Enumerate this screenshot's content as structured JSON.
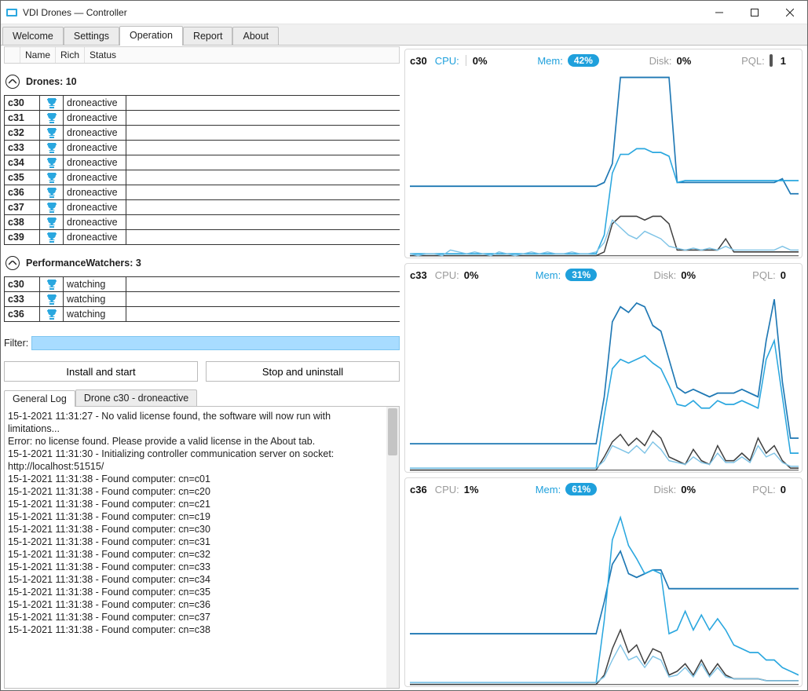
{
  "window": {
    "title": "VDI Drones — Controller"
  },
  "tabs": [
    "Welcome",
    "Settings",
    "Operation",
    "Report",
    "About"
  ],
  "active_tab": "Operation",
  "list_headers": [
    "Name",
    "Rich",
    "Status"
  ],
  "sections": {
    "drones": {
      "title": "Drones: 10",
      "rows": [
        {
          "name": "c30",
          "status": "droneactive"
        },
        {
          "name": "c31",
          "status": "droneactive"
        },
        {
          "name": "c32",
          "status": "droneactive"
        },
        {
          "name": "c33",
          "status": "droneactive"
        },
        {
          "name": "c34",
          "status": "droneactive"
        },
        {
          "name": "c35",
          "status": "droneactive"
        },
        {
          "name": "c36",
          "status": "droneactive"
        },
        {
          "name": "c37",
          "status": "droneactive"
        },
        {
          "name": "c38",
          "status": "droneactive"
        },
        {
          "name": "c39",
          "status": "droneactive"
        }
      ]
    },
    "watchers": {
      "title": "PerformanceWatchers: 3",
      "rows": [
        {
          "name": "c30",
          "status": "watching"
        },
        {
          "name": "c33",
          "status": "watching"
        },
        {
          "name": "c36",
          "status": "watching"
        }
      ]
    }
  },
  "filter": {
    "label": "Filter:",
    "value": ""
  },
  "buttons": {
    "install": "Install and start",
    "stop": "Stop and uninstall"
  },
  "log_tabs": [
    "General Log",
    "Drone c30 - droneactive"
  ],
  "active_log_tab": "General Log",
  "log_lines": [
    "15-1-2021 11:31:27 - No valid license found, the software will now run with limitations...",
    "Error: no license found. Please provide a valid license in the About tab.",
    "15-1-2021 11:31:30 - Initializing controller communication server on socket: http://localhost:51515/",
    "15-1-2021 11:31:38 - Found computer: cn=c01",
    "15-1-2021 11:31:38 - Found computer: cn=c20",
    "15-1-2021 11:31:38 - Found computer: cn=c21",
    "15-1-2021 11:31:38 - Found computer: cn=c19",
    "15-1-2021 11:31:38 - Found computer: cn=c30",
    "15-1-2021 11:31:38 - Found computer: cn=c31",
    "15-1-2021 11:31:38 - Found computer: cn=c32",
    "15-1-2021 11:31:38 - Found computer: cn=c33",
    "15-1-2021 11:31:38 - Found computer: cn=c34",
    "15-1-2021 11:31:38 - Found computer: cn=c35",
    "15-1-2021 11:31:38 - Found computer: cn=c36",
    "15-1-2021 11:31:38 - Found computer: cn=c37",
    "15-1-2021 11:31:38 - Found computer: cn=c38"
  ],
  "panels": [
    {
      "host": "c30",
      "labels": {
        "cpu": "CPU:",
        "mem": "Mem:",
        "disk": "Disk:",
        "pql": "PQL:"
      },
      "cpu": "0%",
      "mem": "42%",
      "disk": "0%",
      "pql": "1",
      "show_pql_ind": true,
      "show_cpu_sep": true
    },
    {
      "host": "c33",
      "labels": {
        "cpu": "CPU:",
        "mem": "Mem:",
        "disk": "Disk:",
        "pql": "PQL:"
      },
      "cpu": "0%",
      "mem": "31%",
      "disk": "0%",
      "pql": "0",
      "show_pql_ind": false,
      "show_cpu_sep": false
    },
    {
      "host": "c36",
      "labels": {
        "cpu": "CPU:",
        "mem": "Mem:",
        "disk": "Disk:",
        "pql": "PQL:"
      },
      "cpu": "1%",
      "mem": "61%",
      "disk": "0%",
      "pql": "0",
      "show_pql_ind": false,
      "show_cpu_sep": false
    }
  ],
  "chart_data": [
    {
      "type": "line",
      "host": "c30",
      "xrange": [
        0,
        480
      ],
      "yrange": [
        0,
        100
      ],
      "series": [
        {
          "name": "mem",
          "color": "#1f78b4",
          "values": [
            38,
            38,
            38,
            38,
            38,
            38,
            38,
            38,
            38,
            38,
            38,
            38,
            38,
            38,
            38,
            38,
            38,
            38,
            38,
            38,
            38,
            38,
            38,
            38,
            40,
            50,
            96,
            96,
            96,
            96,
            96,
            96,
            96,
            40,
            40,
            40,
            40,
            40,
            40,
            40,
            40,
            40,
            40,
            40,
            40,
            40,
            42,
            34,
            34
          ]
        },
        {
          "name": "cpu",
          "color": "#2aa7df",
          "values": [
            2,
            2,
            2,
            2,
            2,
            2,
            2,
            2,
            2,
            2,
            2,
            2,
            2,
            2,
            2,
            2,
            2,
            2,
            2,
            2,
            2,
            2,
            2,
            2,
            12,
            45,
            55,
            55,
            58,
            58,
            56,
            56,
            54,
            40,
            41,
            41,
            41,
            41,
            41,
            41,
            41,
            41,
            41,
            41,
            41,
            41,
            41,
            41,
            41
          ]
        },
        {
          "name": "disk",
          "color": "#3f3f3f",
          "values": [
            1,
            1,
            1,
            1,
            1,
            1,
            1,
            1,
            1,
            1,
            1,
            1,
            1,
            1,
            1,
            1,
            1,
            1,
            1,
            1,
            1,
            1,
            1,
            1,
            3,
            18,
            22,
            22,
            22,
            20,
            22,
            22,
            18,
            4,
            4,
            4,
            4,
            4,
            4,
            10,
            3,
            3,
            3,
            3,
            3,
            3,
            3,
            3,
            3
          ]
        },
        {
          "name": "pql",
          "color": "#7ec3e6",
          "values": [
            2,
            1,
            2,
            2,
            1,
            4,
            3,
            2,
            3,
            2,
            1,
            3,
            2,
            1,
            2,
            3,
            2,
            3,
            2,
            2,
            3,
            2,
            2,
            3,
            8,
            20,
            16,
            12,
            10,
            14,
            12,
            10,
            6,
            5,
            4,
            5,
            4,
            5,
            4,
            6,
            4,
            4,
            4,
            4,
            4,
            4,
            6,
            4,
            4
          ]
        }
      ]
    },
    {
      "type": "line",
      "host": "c33",
      "xrange": [
        0,
        480
      ],
      "yrange": [
        0,
        100
      ],
      "series": [
        {
          "name": "mem",
          "color": "#1f78b4",
          "values": [
            15,
            15,
            15,
            15,
            15,
            15,
            15,
            15,
            15,
            15,
            15,
            15,
            15,
            15,
            15,
            15,
            15,
            15,
            15,
            15,
            15,
            15,
            15,
            15,
            40,
            80,
            88,
            85,
            90,
            88,
            78,
            75,
            60,
            45,
            42,
            44,
            42,
            40,
            42,
            42,
            42,
            44,
            42,
            40,
            70,
            92,
            48,
            18,
            18
          ]
        },
        {
          "name": "cpu",
          "color": "#2aa7df",
          "values": [
            2,
            2,
            2,
            2,
            2,
            2,
            2,
            2,
            2,
            2,
            2,
            2,
            2,
            2,
            2,
            2,
            2,
            2,
            2,
            2,
            2,
            2,
            2,
            2,
            30,
            55,
            60,
            58,
            60,
            62,
            58,
            55,
            46,
            36,
            35,
            38,
            34,
            34,
            38,
            36,
            36,
            38,
            36,
            34,
            60,
            70,
            40,
            10,
            10
          ]
        },
        {
          "name": "disk",
          "color": "#3f3f3f",
          "values": [
            1,
            1,
            1,
            1,
            1,
            1,
            1,
            1,
            1,
            1,
            1,
            1,
            1,
            1,
            1,
            1,
            1,
            1,
            1,
            1,
            1,
            1,
            1,
            1,
            8,
            16,
            20,
            14,
            18,
            14,
            22,
            18,
            8,
            6,
            4,
            12,
            6,
            4,
            14,
            6,
            6,
            10,
            6,
            18,
            10,
            14,
            6,
            2,
            2
          ]
        },
        {
          "name": "pql",
          "color": "#7ec3e6",
          "values": [
            2,
            2,
            2,
            2,
            2,
            2,
            2,
            2,
            2,
            2,
            2,
            2,
            2,
            2,
            2,
            2,
            2,
            2,
            2,
            2,
            2,
            2,
            2,
            2,
            6,
            14,
            12,
            10,
            14,
            10,
            16,
            12,
            6,
            5,
            4,
            8,
            5,
            4,
            10,
            5,
            5,
            8,
            5,
            14,
            8,
            10,
            5,
            3,
            3
          ]
        }
      ]
    },
    {
      "type": "line",
      "host": "c36",
      "xrange": [
        0,
        480
      ],
      "yrange": [
        0,
        100
      ],
      "series": [
        {
          "name": "mem",
          "color": "#1f78b4",
          "values": [
            28,
            28,
            28,
            28,
            28,
            28,
            28,
            28,
            28,
            28,
            28,
            28,
            28,
            28,
            28,
            28,
            28,
            28,
            28,
            28,
            28,
            28,
            28,
            28,
            45,
            65,
            72,
            60,
            58,
            60,
            62,
            62,
            52,
            52,
            52,
            52,
            52,
            52,
            52,
            52,
            52,
            52,
            52,
            52,
            52,
            52,
            52,
            52,
            52
          ]
        },
        {
          "name": "cpu",
          "color": "#2aa7df",
          "values": [
            2,
            2,
            2,
            2,
            2,
            2,
            2,
            2,
            2,
            2,
            2,
            2,
            2,
            2,
            2,
            2,
            2,
            2,
            2,
            2,
            2,
            2,
            2,
            2,
            35,
            78,
            90,
            75,
            68,
            60,
            62,
            60,
            28,
            30,
            40,
            30,
            38,
            30,
            36,
            30,
            22,
            20,
            18,
            18,
            14,
            14,
            10,
            8,
            6
          ]
        },
        {
          "name": "disk",
          "color": "#3f3f3f",
          "values": [
            1,
            1,
            1,
            1,
            1,
            1,
            1,
            1,
            1,
            1,
            1,
            1,
            1,
            1,
            1,
            1,
            1,
            1,
            1,
            1,
            1,
            1,
            1,
            1,
            6,
            20,
            30,
            18,
            22,
            12,
            20,
            18,
            6,
            8,
            12,
            6,
            14,
            6,
            12,
            6,
            4,
            4,
            4,
            4,
            3,
            3,
            3,
            3,
            3
          ]
        },
        {
          "name": "pql",
          "color": "#7ec3e6",
          "values": [
            2,
            2,
            2,
            2,
            2,
            2,
            2,
            2,
            2,
            2,
            2,
            2,
            2,
            2,
            2,
            2,
            2,
            2,
            2,
            2,
            2,
            2,
            2,
            2,
            5,
            14,
            22,
            14,
            16,
            10,
            16,
            14,
            5,
            6,
            10,
            5,
            12,
            5,
            10,
            5,
            4,
            4,
            4,
            4,
            3,
            3,
            3,
            3,
            3
          ]
        }
      ]
    }
  ]
}
